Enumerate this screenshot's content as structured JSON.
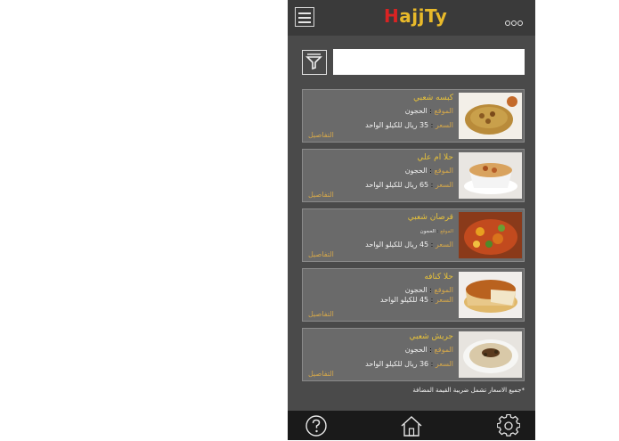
{
  "app": {
    "logo_first": "H",
    "logo_rest": "ajjTy"
  },
  "header": {
    "menu_icon": "hamburger-icon",
    "more_icon": "three-dots-icon"
  },
  "search": {
    "placeholder": "",
    "filter_icon": "funnel-icon"
  },
  "items": [
    {
      "title": "كبسه شعبي",
      "location_label": "الموقع",
      "location": "الحجون",
      "price_label": "السعر",
      "price": "35 ريال للكيلو الواحد",
      "details": "التفاصيل"
    },
    {
      "title": "حلا ام علي",
      "location_label": "الموقع",
      "location": "الحجون",
      "price_label": "السعر",
      "price": "65 ريال للكيلو الواحد",
      "details": "التفاصيل"
    },
    {
      "title": "قرصان شعبي",
      "location_label": "الموقع",
      "location": "الحجون",
      "price_label": "السعر",
      "price": "45 ريال للكيلو الواحد",
      "details": "التفاصيل"
    },
    {
      "title": "حلا كنافه",
      "location_label": "الموقع",
      "location": "الحجون",
      "price_label": "السعر",
      "price": "45 للكيلو الواحد",
      "details": "التفاصيل"
    },
    {
      "title": "جريش شعبي",
      "location_label": "الموقع",
      "location": "الحجون",
      "price_label": "السعر",
      "price": "36 ريال للكيلو الواحد",
      "details": "التفاصيل"
    }
  ],
  "footnote": "*جميع الاسعار تشمل ضريبة القيمة المضافة",
  "bottom_nav": {
    "help_icon": "help-icon",
    "home_icon": "home-icon",
    "settings_icon": "gear-icon"
  },
  "colors": {
    "accent": "#e8c23a",
    "label": "#d4a74a",
    "card_bg": "#6a6a6a",
    "screen_bg": "#4a4a4a",
    "bottom_bar": "#1a1a1a"
  }
}
